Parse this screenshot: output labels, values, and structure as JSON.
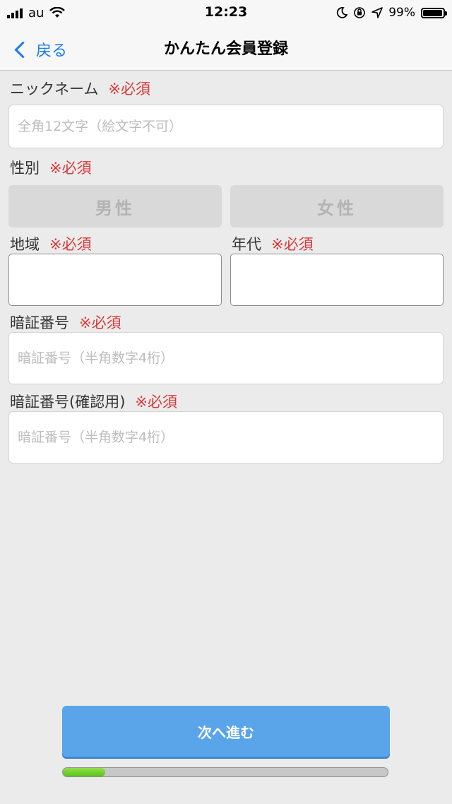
{
  "status_bar": {
    "carrier": "au",
    "time": "12:23",
    "battery": "99%",
    "battery_level": 0.99,
    "icons": [
      "signal-icon",
      "wifi-icon",
      "moon-icon",
      "orientation-lock-icon",
      "location-icon",
      "battery-icon"
    ]
  },
  "nav": {
    "back_label": "戻る",
    "title": "かんたん会員登録"
  },
  "form": {
    "required_mark": "※必須",
    "nickname": {
      "label": "ニックネーム",
      "placeholder": "全角12文字（絵文字不可）",
      "value": ""
    },
    "gender": {
      "label": "性別",
      "options": [
        "男性",
        "女性"
      ]
    },
    "region": {
      "label": "地域",
      "value": ""
    },
    "age": {
      "label": "年代",
      "value": ""
    },
    "pin": {
      "label": "暗証番号",
      "placeholder": "暗証番号（半角数字4桁）",
      "value": ""
    },
    "pin_confirm": {
      "label": "暗証番号(確認用)",
      "placeholder": "暗証番号（半角数字4桁）",
      "value": ""
    }
  },
  "actions": {
    "next_label": "次へ進む"
  },
  "progress": {
    "value": 0.13
  },
  "colors": {
    "accent": "#1a7cf0",
    "required": "#d93939",
    "next_button": "#5aa5ea",
    "progress_fill": "#5cc21d"
  }
}
